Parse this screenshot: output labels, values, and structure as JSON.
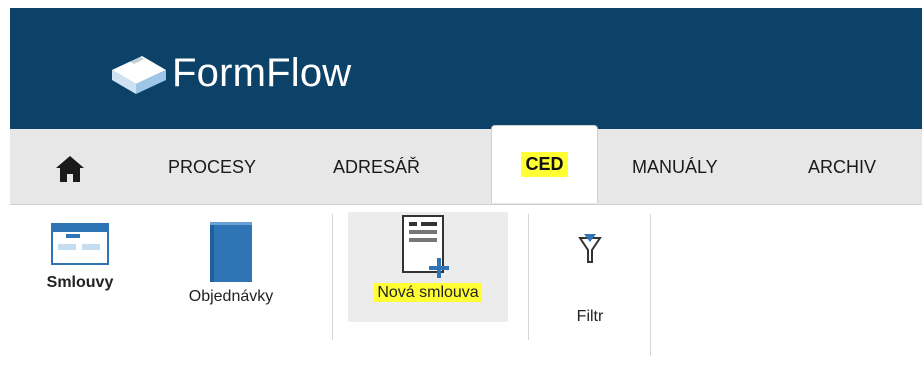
{
  "app": {
    "name": "FormFlow"
  },
  "nav": {
    "home_icon": "home-icon",
    "tabs": [
      {
        "label": "PROCESY"
      },
      {
        "label": "ADRESÁŘ"
      },
      {
        "label": "CED",
        "active": true,
        "highlight": "#ffff33"
      },
      {
        "label": "MANUÁLY"
      },
      {
        "label": "ARCHIV"
      }
    ]
  },
  "ribbon": {
    "items": [
      {
        "label": "Smlouvy",
        "icon": "contracts-icon",
        "bold": true
      },
      {
        "label": "Objednávky",
        "icon": "book-icon"
      },
      {
        "label": "Nová smlouva",
        "icon": "new-document-icon",
        "highlight": "#ffff33"
      },
      {
        "label": "Filtr",
        "icon": "filter-icon"
      }
    ]
  },
  "colors": {
    "header_bg": "#0d4268",
    "nav_bg": "#e7e7e7",
    "accent_blue": "#2f74b5",
    "highlight": "#ffff33"
  }
}
